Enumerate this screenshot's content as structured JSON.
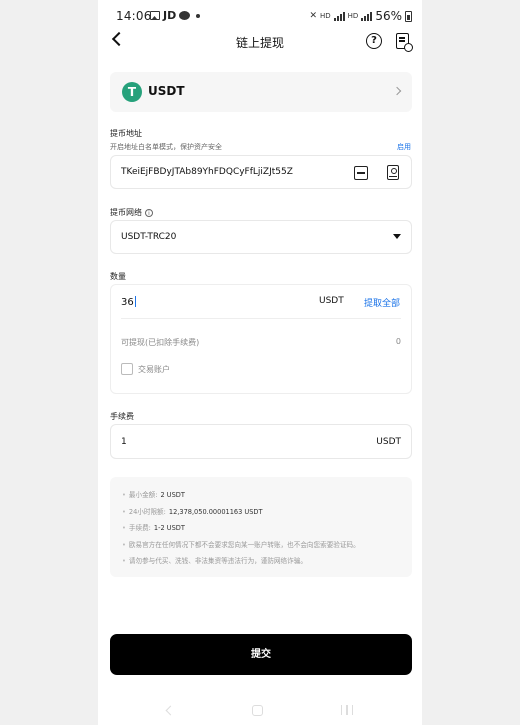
{
  "status_bar": {
    "time": "14:06",
    "jd": "JD",
    "battery": "56%",
    "hd1": "HD",
    "hd2": "HD"
  },
  "header": {
    "title": "链上提现",
    "help_glyph": "?"
  },
  "coin": {
    "name": "USDT",
    "logo_glyph": "T",
    "logo_color": "#26a17b"
  },
  "address": {
    "label": "提币地址",
    "sublabel": "开启地址白名单模式，保护资产安全",
    "enable_link": "启用",
    "value": "TKeiEjFBDyJTAb89YhFDQCyFfLjiZJt55Z"
  },
  "network": {
    "label": "提币网络",
    "info_glyph": "i",
    "value": "USDT-TRC20"
  },
  "quantity": {
    "label": "数量",
    "value": "36",
    "unit": "USDT",
    "withdraw_all": "提取全部",
    "available_label": "可提现(已扣除手续费)",
    "available_value": "0",
    "trading_account_label": "交易账户"
  },
  "fee": {
    "label": "手续费",
    "value": "1",
    "unit": "USDT"
  },
  "notes": {
    "min_label": "最小金额:",
    "min_value": "2 USDT",
    "limit_label": "24小时限额:",
    "limit_value": "12,378,050.00001163 USDT",
    "fee_label": "手续费:",
    "fee_value": "1-2 USDT",
    "warning1": "欧易官方在任何情况下都不会要求您向某一账户转账，也不会向您索要验证码。",
    "warning2": "请勿参与代买、洗钱、非法集资等违法行为，谨防网络诈骗。"
  },
  "submit_label": "提交",
  "colors": {
    "accent": "#1a73e8",
    "button": "#000000"
  }
}
